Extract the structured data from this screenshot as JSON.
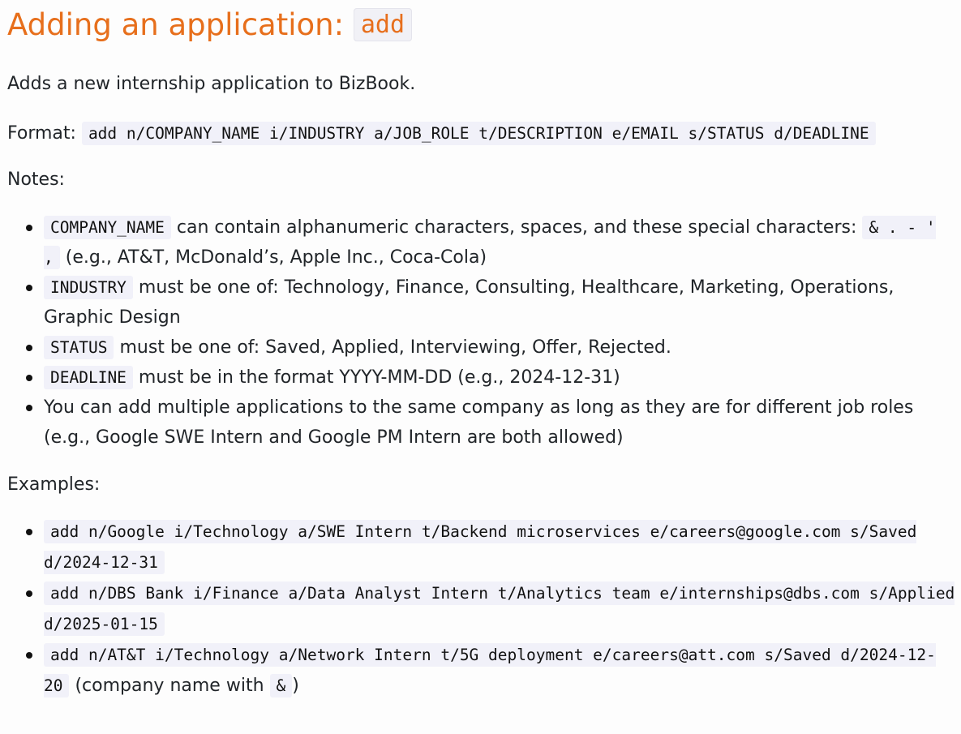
{
  "heading": {
    "text": "Adding an application: ",
    "code": "add"
  },
  "intro": "Adds a new internship application to BizBook.",
  "format": {
    "label": "Format: ",
    "code": "add n/COMPANY_NAME i/INDUSTRY a/JOB_ROLE t/DESCRIPTION e/EMAIL s/STATUS d/DEADLINE"
  },
  "notes": {
    "label": "Notes:",
    "items": [
      {
        "code": "COMPANY_NAME",
        "text1": " can contain alphanumeric characters, spaces, and these special characters: ",
        "code2": "& . - ' ,",
        "text2": " (e.g., AT&T, McDonald’s, Apple Inc., Coca-Cola)"
      },
      {
        "code": "INDUSTRY",
        "text1": " must be one of: Technology, Finance, Consulting, Healthcare, Marketing, Operations, Graphic Design"
      },
      {
        "code": "STATUS",
        "text1": " must be one of: Saved, Applied, Interviewing, Offer, Rejected."
      },
      {
        "code": "DEADLINE",
        "text1": " must be in the format YYYY-MM-DD (e.g., 2024-12-31)"
      },
      {
        "text1": "You can add multiple applications to the same company as long as they are for different job roles (e.g., Google SWE Intern and Google PM Intern are both allowed)"
      }
    ]
  },
  "examples": {
    "label": "Examples:",
    "items": [
      {
        "code": "add n/Google i/Technology a/SWE Intern t/Backend microservices e/careers@google.com s/Saved d/2024-12-31"
      },
      {
        "code": "add n/DBS Bank i/Finance a/Data Analyst Intern t/Analytics team e/internships@dbs.com s/Applied d/2025-01-15"
      },
      {
        "code": "add n/AT&T i/Technology a/Network Intern t/5G deployment e/careers@att.com s/Saved d/2024-12-20",
        "text1": " (company name with ",
        "code2": "&",
        "text2": ")"
      }
    ]
  }
}
